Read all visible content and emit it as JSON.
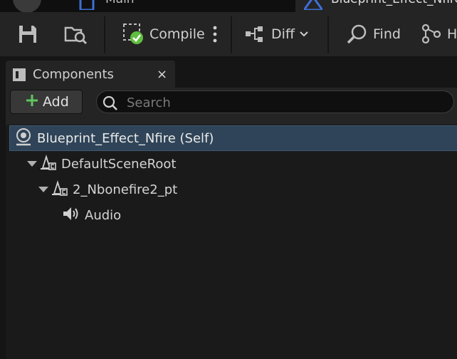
{
  "tabs": [
    {
      "label": "Main"
    },
    {
      "label": "Blueprint_Effect_Nfire"
    }
  ],
  "toolbar": {
    "compile_label": "Compile",
    "diff_label": "Diff",
    "find_label": "Find",
    "hierarchy_label": "H"
  },
  "components_panel": {
    "title": "Components",
    "close_glyph": "×",
    "add_label": "Add",
    "search_placeholder": "Search",
    "search_value": ""
  },
  "tree": [
    {
      "label": "Blueprint_Effect_Nfire (Self)",
      "icon": "actor-self-icon",
      "selected": true
    },
    {
      "label": "DefaultSceneRoot",
      "icon": "scene-component-icon",
      "expanded": true
    },
    {
      "label": "2_Nbonefire2_pt",
      "icon": "particle-component-icon",
      "expanded": true
    },
    {
      "label": "Audio",
      "icon": "speaker-icon"
    }
  ],
  "colors": {
    "accent_selected": "#2f4458",
    "add_plus": "#5fc65f",
    "compile_ok": "#5fbf3f"
  }
}
